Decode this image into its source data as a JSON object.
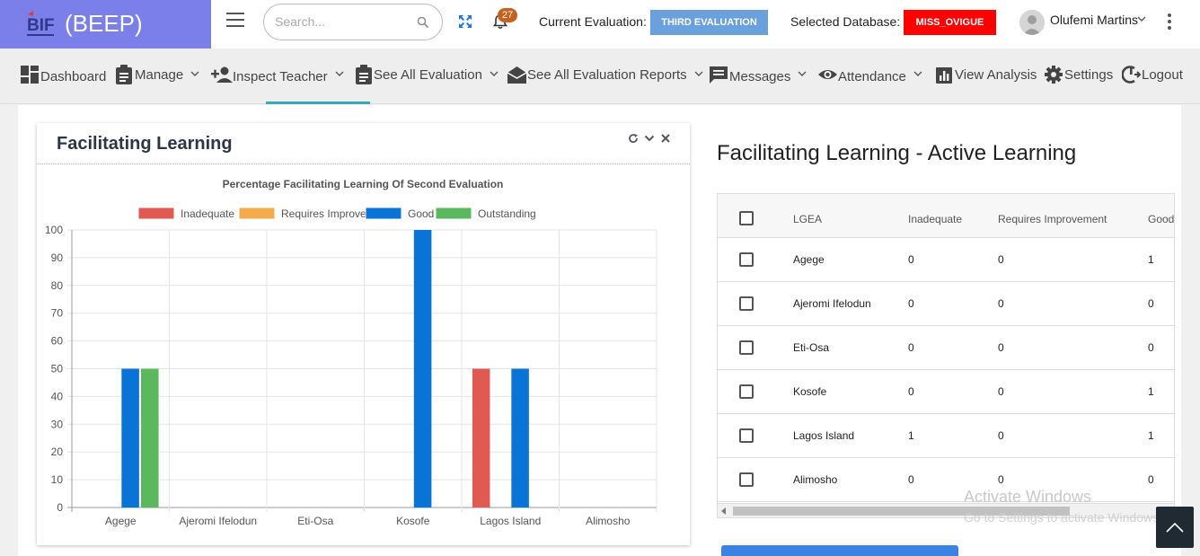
{
  "brand": {
    "logo_text": "BIF",
    "title": "(BEEP)"
  },
  "search": {
    "placeholder": "Search..."
  },
  "notifications": {
    "count": "27"
  },
  "evaluation": {
    "label": "Current Evaluation:",
    "value": "THIRD EVALUATION"
  },
  "database": {
    "label": "Selected Database:",
    "value": "MISS_OVIGUE"
  },
  "user": {
    "name": "Olufemi Martins"
  },
  "nav": {
    "dashboard": "Dashboard",
    "manage": "Manage",
    "inspect": "Inspect Teacher",
    "see_all_eval": "See All Evaluation",
    "see_all_reports": "See All Evaluation Reports",
    "messages": "Messages",
    "attendance": "Attendance",
    "view_analysis": "View Analysis",
    "settings": "Settings",
    "logout": "Logout"
  },
  "card": {
    "title": "Facilitating Learning"
  },
  "chart_data": {
    "type": "bar",
    "title": "Percentage Facilitating Learning Of Second Evaluation",
    "categories": [
      "Agege",
      "Ajeromi Ifelodun",
      "Eti-Osa",
      "Kosofe",
      "Lagos Island",
      "Alimosho"
    ],
    "series": [
      {
        "name": "Inadequate",
        "color": "#e05a51",
        "values": [
          0,
          0,
          0,
          0,
          50,
          0
        ]
      },
      {
        "name": "Requires Improvement",
        "color": "#f2ac4e",
        "values": [
          0,
          0,
          0,
          0,
          0,
          0
        ]
      },
      {
        "name": "Good",
        "color": "#0a74d6",
        "values": [
          50,
          0,
          0,
          100,
          50,
          0
        ]
      },
      {
        "name": "Outstanding",
        "color": "#5cb85c",
        "values": [
          50,
          0,
          0,
          0,
          0,
          0
        ]
      }
    ],
    "ylim": [
      0,
      100
    ],
    "yticks": [
      0,
      10,
      20,
      30,
      40,
      50,
      60,
      70,
      80,
      90,
      100
    ],
    "legend": "top",
    "grid": true
  },
  "table": {
    "title": "Facilitating Learning - Active Learning",
    "headers": [
      "LGEA",
      "Inadequate",
      "Requires Improvement",
      "Good"
    ],
    "rows": [
      [
        "Agege",
        "0",
        "0",
        "1"
      ],
      [
        "Ajeromi Ifelodun",
        "0",
        "0",
        "0"
      ],
      [
        "Eti-Osa",
        "0",
        "0",
        "0"
      ],
      [
        "Kosofe",
        "0",
        "0",
        "1"
      ],
      [
        "Lagos Island",
        "1",
        "0",
        "1"
      ],
      [
        "Alimosho",
        "0",
        "0",
        "0"
      ]
    ]
  },
  "watermark": {
    "line1": "Activate Windows",
    "line2": "Go to Settings to activate Windows."
  },
  "colors": {
    "brand": "#7a7fe9",
    "evaluation_badge": "#6aa0dc",
    "database_badge": "#ff0000",
    "notification_badge": "#c8611e",
    "active_tab": "#3aa6b9"
  }
}
